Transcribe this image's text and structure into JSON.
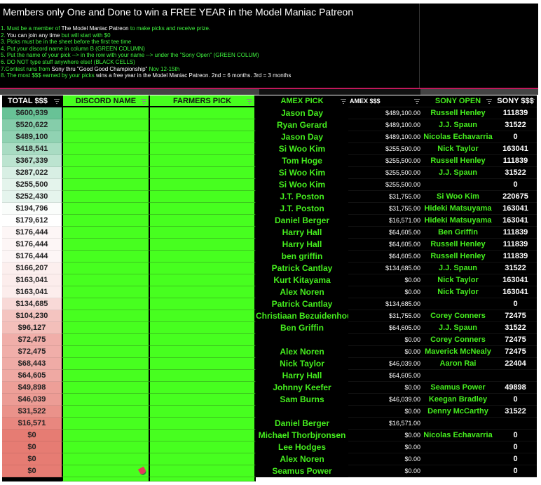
{
  "banner": {
    "title": "Members only One and Done to win a FREE YEAR in the Model Maniac Patreon",
    "rules": [
      [
        [
          "1. Must be a member of ",
          "g"
        ],
        [
          "The Model Maniac Patreon",
          "w"
        ],
        [
          " to make picks and receive prize.",
          "g"
        ]
      ],
      [
        [
          "2. ",
          "g"
        ],
        [
          "You can join any time",
          "w"
        ],
        [
          " but will start with $0",
          "g"
        ]
      ],
      [
        [
          "3. Picks must be in the sheet before the first tee time",
          "g"
        ]
      ],
      [
        [
          "4. Put your discord name in column B (GREEN COLUMN)",
          "g"
        ]
      ],
      [
        [
          "5. Put the name of your pick --> in the row with your name --> under the \"Sony Open\" (GREEN COLUM)",
          "g"
        ]
      ],
      [
        [
          "6. DO NOT type stuff anywhere else! (BLACK CELLS)",
          "g"
        ]
      ],
      [
        [
          "7.Contest runs from ",
          "g"
        ],
        [
          "Sony thru \"Good Good Championship\"",
          "w"
        ],
        [
          " Nov 12-15th",
          "g"
        ]
      ],
      [
        [
          "8. The most $$$ earned by your picks ",
          "g"
        ],
        [
          "wins a free year in the Model Maniac Patreon. 2nd = 6 months. 3rd = 3 months",
          "w"
        ]
      ]
    ]
  },
  "headers": [
    "TOTAL $$$",
    "DISCORD NAME",
    "FARMERS PICK",
    "AMEX PICK",
    "AMEX $$$",
    "SONY OPEN",
    "SONY $$$"
  ],
  "colors": {
    "green_cell": "#47ff1f",
    "pick_text": "#45ee1e",
    "total_high": "#57bb8a",
    "total_mid": "#ffffff",
    "total_low": "#e67c73"
  },
  "rows": [
    {
      "total": "$600,939",
      "amex_pick": "Jason Day",
      "amex": "$489,100.00",
      "sony_pick": "Russell Henley",
      "sony": "111839"
    },
    {
      "total": "$520,622",
      "amex_pick": "Ryan Gerard",
      "amex": "$489,100.00",
      "sony_pick": "J.J. Spaun",
      "sony": "31522"
    },
    {
      "total": "$489,100",
      "amex_pick": "Jason Day",
      "amex": "$489,100.00",
      "sony_pick": "Nicolas Echavarria",
      "sony": "0"
    },
    {
      "total": "$418,541",
      "amex_pick": "Si Woo Kim",
      "amex": "$255,500.00",
      "sony_pick": "Nick Taylor",
      "sony": "163041"
    },
    {
      "total": "$367,339",
      "amex_pick": "Tom Hoge",
      "amex": "$255,500.00",
      "sony_pick": "Russell Henley",
      "sony": "111839"
    },
    {
      "total": "$287,022",
      "amex_pick": "Si Woo Kim",
      "amex": "$255,500.00",
      "sony_pick": "J.J. Spaun",
      "sony": "31522"
    },
    {
      "total": "$255,500",
      "amex_pick": "Si Woo Kim",
      "amex": "$255,500.00",
      "sony_pick": "",
      "sony": "0"
    },
    {
      "total": "$252,430",
      "amex_pick": "J.T. Poston",
      "amex": "$31,755.00",
      "sony_pick": "Si Woo Kim",
      "sony": "220675"
    },
    {
      "total": "$194,796",
      "amex_pick": "J.T. Poston",
      "amex": "$31,755.00",
      "sony_pick": "Hideki Matsuyama",
      "sony": "163041"
    },
    {
      "total": "$179,612",
      "amex_pick": "Daniel Berger",
      "amex": "$16,571.00",
      "sony_pick": "Hideki Matsuyama",
      "sony": "163041"
    },
    {
      "total": "$176,444",
      "amex_pick": "Harry Hall",
      "amex": "$64,605.00",
      "sony_pick": "Ben Griffin",
      "sony": "111839"
    },
    {
      "total": "$176,444",
      "amex_pick": "Harry Hall",
      "amex": "$64,605.00",
      "sony_pick": "Russell Henley",
      "sony": "111839"
    },
    {
      "total": "$176,444",
      "amex_pick": "ben griffin",
      "amex": "$64,605.00",
      "sony_pick": "Russell Henley",
      "sony": "111839"
    },
    {
      "total": "$166,207",
      "amex_pick": "Patrick Cantlay",
      "amex": "$134,685.00",
      "sony_pick": "J.J. Spaun",
      "sony": "31522"
    },
    {
      "total": "$163,041",
      "amex_pick": "Kurt Kitayama",
      "amex": "$0.00",
      "sony_pick": "Nick Taylor",
      "sony": "163041"
    },
    {
      "total": "$163,041",
      "amex_pick": "Alex Noren",
      "amex": "$0.00",
      "sony_pick": "Nick Taylor",
      "sony": "163041"
    },
    {
      "total": "$134,685",
      "amex_pick": "Patrick Cantlay",
      "amex": "$134,685.00",
      "sony_pick": "",
      "sony": "0"
    },
    {
      "total": "$104,230",
      "amex_pick": "Christiaan Bezuidenhou",
      "amex": "$31,755.00",
      "sony_pick": "Corey Conners",
      "sony": "72475"
    },
    {
      "total": "$96,127",
      "amex_pick": "Ben Griffin",
      "amex": "$64,605.00",
      "sony_pick": "J.J. Spaun",
      "sony": "31522"
    },
    {
      "total": "$72,475",
      "amex_pick": "",
      "amex": "$0.00",
      "sony_pick": "Corey Conners",
      "sony": "72475"
    },
    {
      "total": "$72,475",
      "amex_pick": "Alex Noren",
      "amex": "$0.00",
      "sony_pick": "Maverick McNealy",
      "sony": "72475"
    },
    {
      "total": "$68,443",
      "amex_pick": "Nick Taylor",
      "amex": "$46,039.00",
      "sony_pick": "Aaron Rai",
      "sony": "22404"
    },
    {
      "total": "$64,605",
      "amex_pick": "Harry Hall",
      "amex": "$64,605.00",
      "sony_pick": "",
      "sony": ""
    },
    {
      "total": "$49,898",
      "amex_pick": "Johnny Keefer",
      "amex": "$0.00",
      "sony_pick": "Seamus Power",
      "sony": "49898"
    },
    {
      "total": "$46,039",
      "amex_pick": "Sam Burns",
      "amex": "$46,039.00",
      "sony_pick": "Keegan Bradley",
      "sony": "0"
    },
    {
      "total": "$31,522",
      "amex_pick": "",
      "amex": "$0.00",
      "sony_pick": "Denny McCarthy",
      "sony": "31522"
    },
    {
      "total": "$16,571",
      "amex_pick": "Daniel Berger",
      "amex": "$16,571.00",
      "sony_pick": "",
      "sony": ""
    },
    {
      "total": "$0",
      "amex_pick": "Michael Thorbjronsen",
      "amex": "$0.00",
      "sony_pick": "Nicolas Echavarria",
      "sony": "0"
    },
    {
      "total": "$0",
      "amex_pick": "Lee Hodges",
      "amex": "$0.00",
      "sony_pick": "",
      "sony": "0"
    },
    {
      "total": "$0",
      "amex_pick": "Alex Noren",
      "amex": "$0.00",
      "sony_pick": "",
      "sony": "0"
    },
    {
      "total": "$0",
      "amex_pick": "Seamus Power",
      "amex": "$0.00",
      "sony_pick": "",
      "sony": "0"
    }
  ]
}
